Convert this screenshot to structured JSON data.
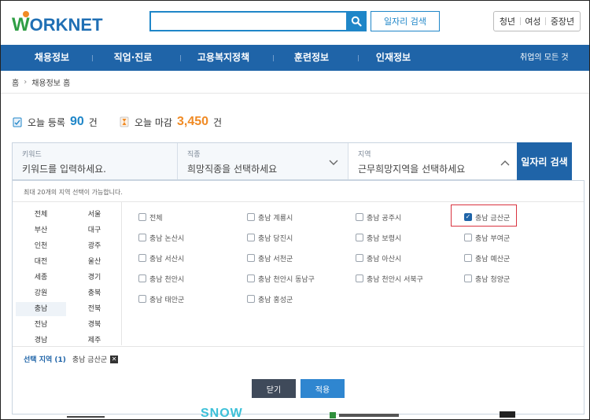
{
  "header": {
    "logo_w": "W",
    "logo_rest": "ORKNET",
    "search_placeholder": "",
    "job_search_button": "일자리 검색",
    "user_links": [
      "청년",
      "여성",
      "중장년"
    ]
  },
  "nav": {
    "items": [
      "채용정보",
      "직업·진로",
      "고용복지정책",
      "훈련정보",
      "인재정보"
    ],
    "all_services": "취업의 모든 것"
  },
  "breadcrumb": {
    "home": "홈",
    "current": "채용정보 홈"
  },
  "stats": {
    "today_register_label": "오늘 등록",
    "today_register_value": "90",
    "today_register_unit": "건",
    "today_close_label": "오늘 마감",
    "today_close_value": "3,450",
    "today_close_unit": "건"
  },
  "filter": {
    "keyword_label": "키워드",
    "keyword_placeholder": "키워드를 입력하세요.",
    "job_label": "직종",
    "job_placeholder": "희망직종을 선택하세요",
    "region_label": "지역",
    "region_placeholder": "근무희망지역을 선택하세요",
    "search_button": "일자리 검색"
  },
  "dropdown": {
    "note": "최대 20개의 지역 선택이 가능합니다.",
    "regions": [
      "전체",
      "서울",
      "부산",
      "대구",
      "인천",
      "광주",
      "대전",
      "울산",
      "세종",
      "경기",
      "강원",
      "충북",
      "충남",
      "전북",
      "전남",
      "경북",
      "경남",
      "제주"
    ],
    "active_region": "충남",
    "options": [
      {
        "label": "전체",
        "checked": false
      },
      {
        "label": "충남 계룡시",
        "checked": false
      },
      {
        "label": "충남 공주시",
        "checked": false
      },
      {
        "label": "충남 금산군",
        "checked": true
      },
      {
        "label": "충남 논산시",
        "checked": false
      },
      {
        "label": "충남 당진시",
        "checked": false
      },
      {
        "label": "충남 보령시",
        "checked": false
      },
      {
        "label": "충남 부여군",
        "checked": false
      },
      {
        "label": "충남 서산시",
        "checked": false
      },
      {
        "label": "충남 서천군",
        "checked": false
      },
      {
        "label": "충남 아산시",
        "checked": false
      },
      {
        "label": "충남 예산군",
        "checked": false
      },
      {
        "label": "충남 천안시",
        "checked": false
      },
      {
        "label": "충남 천안시 동남구",
        "checked": false
      },
      {
        "label": "충남 천안시 서북구",
        "checked": false
      },
      {
        "label": "충남 청양군",
        "checked": false
      },
      {
        "label": "충남 태안군",
        "checked": false
      },
      {
        "label": "충남 홍성군",
        "checked": false
      }
    ],
    "selected_label": "선택 지역 (1)",
    "selected_chip": "충남 금산군",
    "close_button": "닫기",
    "apply_button": "적용"
  },
  "bottom": {
    "snow": "SNOW"
  },
  "colors": {
    "brand_blue": "#1f64a8",
    "accent_blue": "#1f86c8",
    "accent_orange": "#f08a24",
    "highlight_red": "#d9333f"
  }
}
